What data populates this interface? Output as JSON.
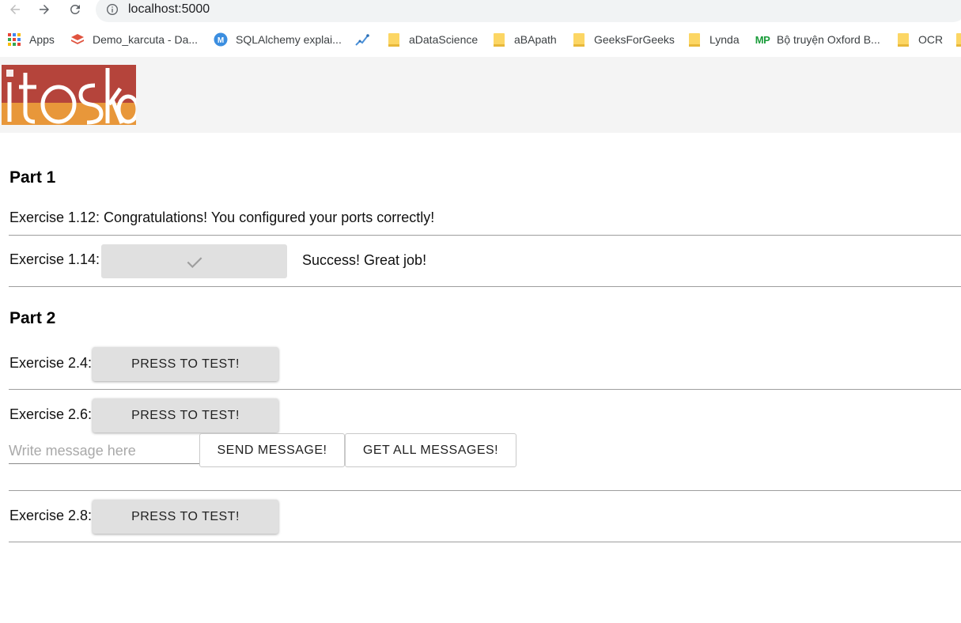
{
  "browser": {
    "url": "localhost:5000",
    "bookmarks": [
      {
        "label": "Apps",
        "icon": "apps-grid-icon"
      },
      {
        "label": "Demo_karcuta - Da...",
        "icon": "layers-icon"
      },
      {
        "label": "SQLAlchemy explai...",
        "icon": "medium-icon"
      },
      {
        "label": "",
        "icon": "chart-icon"
      },
      {
        "label": "aDataScience",
        "icon": "folder-icon"
      },
      {
        "label": "aBApath",
        "icon": "folder-icon"
      },
      {
        "label": "GeeksForGeeks",
        "icon": "folder-icon"
      },
      {
        "label": "Lynda",
        "icon": "folder-icon"
      },
      {
        "label": "Bộ truyện Oxford B...",
        "icon": "mp-icon",
        "icon_text": "MP"
      },
      {
        "label": "OCR",
        "icon": "folder-icon"
      }
    ]
  },
  "colors": {
    "logo_red": "#b5443b",
    "logo_orange": "#e8973a",
    "header_bg": "#f4f4f4",
    "button_gray": "#e0e0e0"
  },
  "part1": {
    "title": "Part 1",
    "ex112_text": "Exercise 1.12: Congratulations! You configured your ports correctly!",
    "ex114_label": "Exercise 1.14:",
    "ex114_status": "Success! Great job!"
  },
  "part2": {
    "title": "Part 2",
    "ex24_label": "Exercise 2.4:",
    "ex26_label": "Exercise 2.6:",
    "ex28_label": "Exercise 2.8:",
    "press_button": "PRESS TO TEST!",
    "message_placeholder": "Write message here",
    "message_value": "",
    "send_button": "SEND MESSAGE!",
    "get_all_button": "GET ALL MESSAGES!"
  }
}
